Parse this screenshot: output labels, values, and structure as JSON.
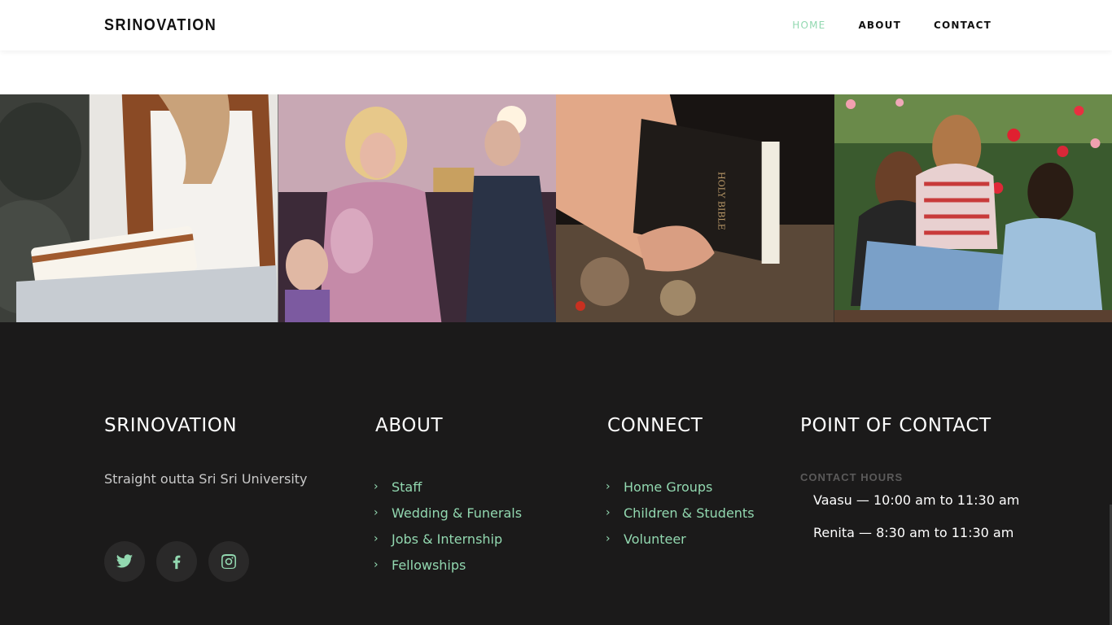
{
  "header": {
    "brand": "SRINOVATION",
    "nav": [
      {
        "label": "HOME",
        "active": true
      },
      {
        "label": "ABOUT",
        "active": false
      },
      {
        "label": "CONTACT",
        "active": false
      }
    ]
  },
  "gallery": [
    {
      "alt": "woman reading a book"
    },
    {
      "alt": "woman singing at worship service"
    },
    {
      "alt": "hand holding a Holy Bible",
      "book_text": "HOLY BIBLE"
    },
    {
      "alt": "three girls sitting among tulips"
    }
  ],
  "footer": {
    "about_col": {
      "title": "SRINOVATION",
      "tagline": "Straight outta Sri Sri University"
    },
    "about_links": {
      "title": "ABOUT",
      "items": [
        "Staff",
        "Wedding & Funerals",
        "Jobs & Internship",
        "Fellowships"
      ]
    },
    "connect": {
      "title": "CONNECT",
      "items": [
        "Home Groups",
        "Children & Students",
        "Volunteer"
      ]
    },
    "contact": {
      "title": "POINT OF CONTACT",
      "hours_label": "CONTACT HOURS",
      "hours": [
        "Vaasu — 10:00 am to 11:30 am",
        "Renita — 8:30 am to 11:30 am"
      ]
    },
    "social": [
      {
        "icon": "twitter-icon"
      },
      {
        "icon": "facebook-icon"
      },
      {
        "icon": "instagram-icon"
      }
    ]
  },
  "colors": {
    "accent": "#92d8b0",
    "footer_bg": "#1b1a1a",
    "social_bg": "#2a2929"
  }
}
